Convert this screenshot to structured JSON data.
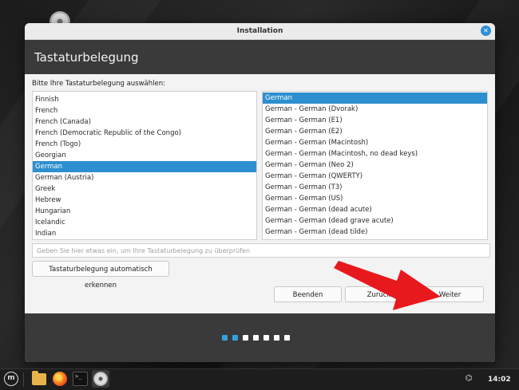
{
  "window": {
    "title": "Installation",
    "minimize_glyph": "⌄",
    "close_glyph": "✕"
  },
  "page": {
    "heading": "Tastaturbelegung",
    "prompt": "Bitte Ihre Tastaturbelegung auswählen:"
  },
  "layouts": {
    "selected": "German",
    "items": [
      "Finnish",
      "French",
      "French (Canada)",
      "French (Democratic Republic of the Congo)",
      "French (Togo)",
      "Georgian",
      "German",
      "German (Austria)",
      "Greek",
      "Hebrew",
      "Hungarian",
      "Icelandic",
      "Indian"
    ]
  },
  "variants": {
    "selected": "German",
    "items": [
      "German",
      "German - German (Dvorak)",
      "German - German (E1)",
      "German - German (E2)",
      "German - German (Macintosh)",
      "German - German (Macintosh, no dead keys)",
      "German - German (Neo 2)",
      "German - German (QWERTY)",
      "German - German (T3)",
      "German - German (US)",
      "German - German (dead acute)",
      "German - German (dead grave acute)",
      "German - German (dead tilde)"
    ]
  },
  "test_field": {
    "value": "",
    "placeholder": "Geben Sie hier etwas ein, um Ihre Tastaturbelegung zu überprüfen"
  },
  "buttons": {
    "detect": "Tastaturbelegung automatisch erkennen",
    "quit": "Beenden",
    "back": "Zurück",
    "next": "Weiter"
  },
  "progress": {
    "total_steps": 7,
    "active_steps": [
      1,
      2
    ]
  },
  "colors": {
    "accent": "#2d8fcf",
    "header_bg": "#3a3a3a",
    "annotation_arrow": "#e8191c"
  },
  "taskbar": {
    "menu_icon": "mint-menu-icon",
    "launchers": [
      "folder-icon",
      "firefox-icon",
      "terminal-icon",
      "disc-icon"
    ],
    "terminal_glyph": ">_",
    "tray": [
      "network-icon"
    ],
    "clock": "14:02"
  }
}
